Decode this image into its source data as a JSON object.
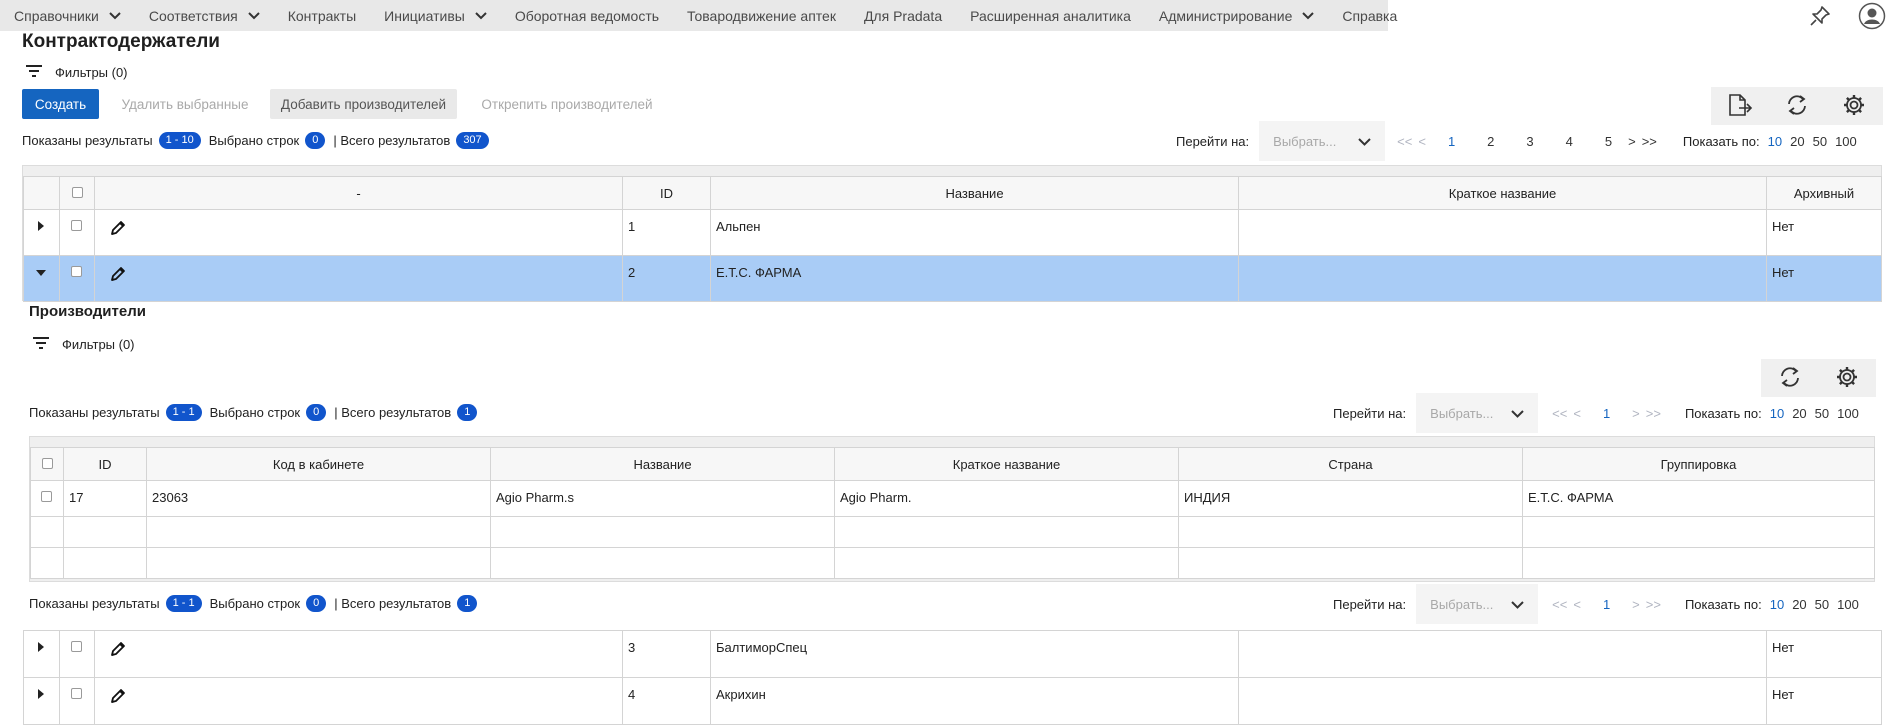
{
  "nav": {
    "items": [
      {
        "label": "Справочники",
        "dropdown": true
      },
      {
        "label": "Соответствия",
        "dropdown": true
      },
      {
        "label": "Контракты",
        "dropdown": false
      },
      {
        "label": "Инициативы",
        "dropdown": true
      },
      {
        "label": "Оборотная ведомость",
        "dropdown": false
      },
      {
        "label": "Товародвижение аптек",
        "dropdown": false
      },
      {
        "label": "Для Pradata",
        "dropdown": false
      },
      {
        "label": "Расширенная аналитика",
        "dropdown": false
      },
      {
        "label": "Администрирование",
        "dropdown": true
      },
      {
        "label": "Справка",
        "dropdown": false
      }
    ],
    "icons": [
      "pin-icon",
      "user-avatar-icon"
    ]
  },
  "page": {
    "title": "Контрактодержатели",
    "filters_label": "Фильтры (0)"
  },
  "toolbar": {
    "create": "Создать",
    "delete_selected": "Удалить выбранные",
    "add_manufacturers": "Добавить производителей",
    "detach_manufacturers": "Открепить производителей",
    "icons": [
      "export-icon",
      "refresh-icon",
      "settings-icon"
    ]
  },
  "results": {
    "shown_label": "Показаны результаты",
    "shown_value": "1 - 10",
    "selected_label": "Выбрано строк",
    "selected_value": "0",
    "total_label": "| Всего результатов",
    "total_value": "307"
  },
  "pager": {
    "goto_label": "Перейти на:",
    "goto_placeholder": "Выбрать...",
    "first": "<<",
    "prev": "<",
    "pages": [
      "1",
      "2",
      "3",
      "4",
      "5"
    ],
    "active_page": "1",
    "next": ">",
    "last": ">>",
    "page_size_label": "Показать по:",
    "page_sizes": [
      "10",
      "20",
      "50",
      "100"
    ],
    "active_page_size": "10"
  },
  "main_table": {
    "columns": [
      "-",
      "ID",
      "Название",
      "Краткое название",
      "Архивный"
    ],
    "rows": [
      {
        "id": "1",
        "name": "Альпен",
        "short": "",
        "archived": "Нет",
        "expanded": false
      },
      {
        "id": "2",
        "name": "Е.Т.С. ФАРМА",
        "short": "",
        "archived": "Нет",
        "expanded": true
      },
      {
        "id": "3",
        "name": "БалтиморСпец",
        "short": "",
        "archived": "Нет",
        "expanded": false
      },
      {
        "id": "4",
        "name": "Акрихин",
        "short": "",
        "archived": "Нет",
        "expanded": false
      }
    ]
  },
  "sub": {
    "title": "Производители",
    "filters_label": "Фильтры (0)",
    "results": {
      "shown_label": "Показаны результаты",
      "shown_value": "1 - 1",
      "selected_label": "Выбрано строк",
      "selected_value": "0",
      "total_label": "| Всего результатов",
      "total_value": "1"
    },
    "pager": {
      "goto_label": "Перейти на:",
      "goto_placeholder": "Выбрать...",
      "first": "<<",
      "prev": "<",
      "pages": [
        "1"
      ],
      "active_page": "1",
      "next": ">",
      "last": ">>",
      "page_size_label": "Показать по:",
      "page_sizes": [
        "10",
        "20",
        "50",
        "100"
      ],
      "active_page_size": "10"
    },
    "columns": [
      "ID",
      "Код в кабинете",
      "Название",
      "Краткое название",
      "Страна",
      "Группировка"
    ],
    "rows": [
      {
        "id": "17",
        "code": "23063",
        "name": "Agio Pharm.s",
        "short": "Agio Pharm.",
        "country": "ИНДИЯ",
        "group": "Е.Т.С. ФАРМА"
      }
    ]
  },
  "colors": {
    "accent": "#1565c0",
    "badge": "#1155cc",
    "selected_row": "#a9ccf6",
    "nav_bg": "#e8e8e8"
  }
}
